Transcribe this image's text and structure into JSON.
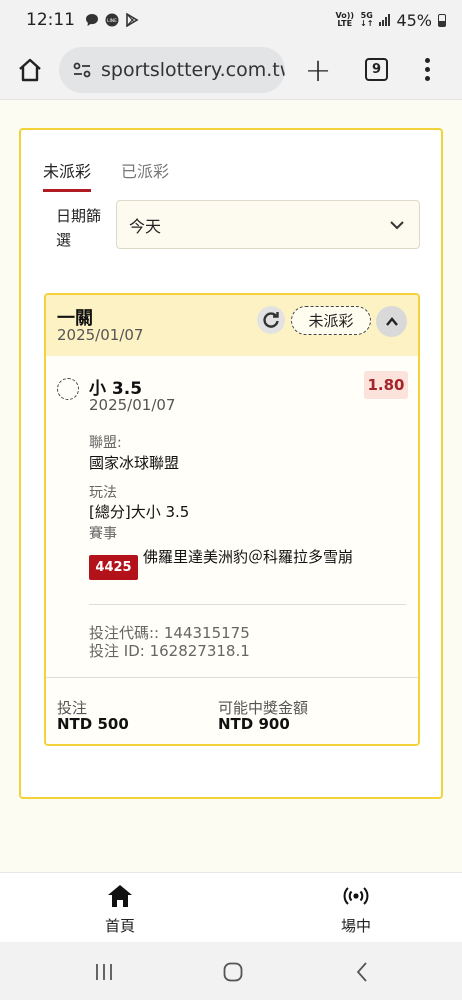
{
  "status_bar": {
    "time": "12:11",
    "network_1_top": "Vo))",
    "network_1_bottom": "LTE",
    "network_2_top": "5G",
    "network_2_bottom": "↓↑",
    "battery": "45%"
  },
  "browser": {
    "url": "sportslottery.com.tw",
    "tab_count": "9"
  },
  "tabs": [
    {
      "label": "未派彩",
      "active": true
    },
    {
      "label": "已派彩",
      "active": false
    }
  ],
  "filter": {
    "label": "日期篩選",
    "selected": "今天"
  },
  "bet": {
    "type": "一關",
    "date": "2025/01/07",
    "status": "未派彩",
    "selection": {
      "name": "小 3.5",
      "date": "2025/01/07",
      "odds": "1.80",
      "league_label": "聯盟:",
      "league": "國家冰球聯盟",
      "market_label": "玩法",
      "market": "[總分]大小 3.5",
      "event_label": "賽事",
      "event_code": "4425",
      "event_name": "佛羅里達美洲豹＠科羅拉多雪崩"
    },
    "code_line": "投注代碼:: 144315175",
    "id_line": "投注 ID: 162827318.1",
    "stake_label": "投注",
    "stake_value": "NTD 500",
    "payout_label": "可能中獎金額",
    "payout_value": "NTD 900"
  },
  "bottom_nav": [
    {
      "label": "首頁",
      "icon": "home-icon"
    },
    {
      "label": "場中",
      "icon": "live-icon"
    }
  ],
  "colors": {
    "accent_yellow": "#f3d23a",
    "header_yellow": "#fdf2c4",
    "brand_red": "#b3121b",
    "odds_red": "#a3252b",
    "odds_bg": "#fbe3dc"
  }
}
